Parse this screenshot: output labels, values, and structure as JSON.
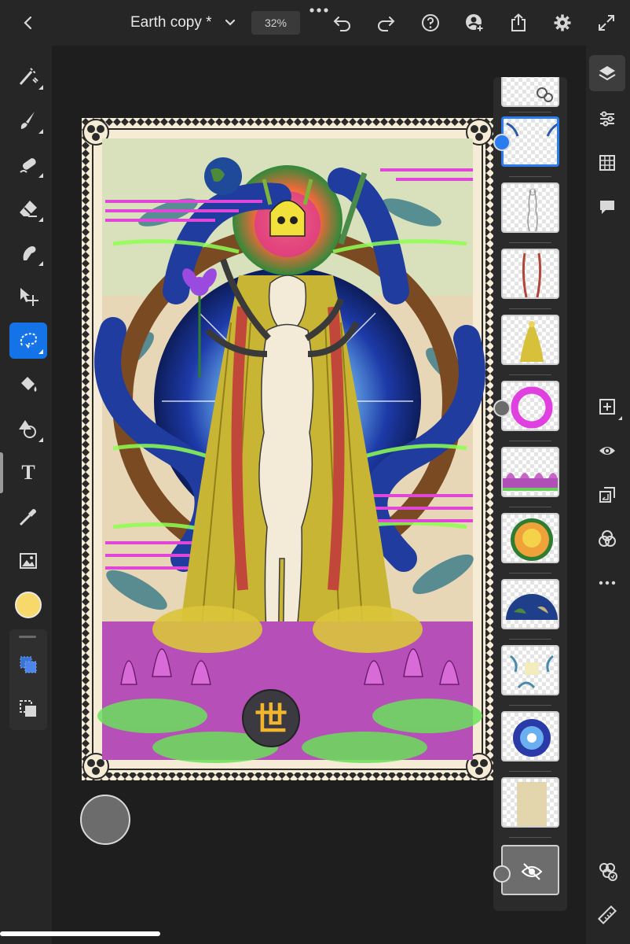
{
  "app": {
    "document_title": "Earth copy *",
    "zoom_level": "32%"
  },
  "topbar": {
    "back_icon": "chevron-left-icon",
    "title_dropdown_icon": "chevron-down-icon",
    "more_icon": "ellipsis-icon",
    "undo_icon": "undo-icon",
    "redo_icon": "redo-icon",
    "help_icon": "help-icon",
    "add_person_icon": "invite-person-icon",
    "share_icon": "share-icon",
    "settings_icon": "gear-icon",
    "fullscreen_icon": "expand-icon"
  },
  "left_tools": [
    {
      "name": "select-subject-tool",
      "icon": "magic-brush-icon"
    },
    {
      "name": "brush-tool",
      "icon": "brush-icon"
    },
    {
      "name": "healing-tool",
      "icon": "healing-brush-icon"
    },
    {
      "name": "eraser-tool",
      "icon": "eraser-icon"
    },
    {
      "name": "smudge-tool",
      "icon": "smudge-icon"
    },
    {
      "name": "move-tool",
      "icon": "move-icon"
    },
    {
      "name": "lasso-tool",
      "icon": "lasso-icon",
      "active": true
    },
    {
      "name": "fill-tool",
      "icon": "paint-bucket-icon"
    },
    {
      "name": "shape-tool",
      "icon": "shape-icon"
    },
    {
      "name": "type-tool",
      "icon": "type-icon",
      "glyph": "T"
    },
    {
      "name": "eyedropper-tool",
      "icon": "eyedropper-icon"
    },
    {
      "name": "place-image-tool",
      "icon": "image-icon"
    }
  ],
  "foreground_color": "#f7d86b",
  "accent_color": "#1473e6",
  "right_tools": [
    {
      "name": "layers-button",
      "icon": "layers-icon",
      "active": true
    },
    {
      "name": "adjustments-button",
      "icon": "sliders-icon"
    },
    {
      "name": "grid-button",
      "icon": "grid-icon"
    },
    {
      "name": "comments-button",
      "icon": "comment-icon"
    },
    {
      "name": "add-layer-button",
      "icon": "add-layer-icon"
    },
    {
      "name": "visibility-button",
      "icon": "eye-icon"
    },
    {
      "name": "merge-down-button",
      "icon": "merge-icon"
    },
    {
      "name": "blend-mode-button",
      "icon": "blend-icon"
    },
    {
      "name": "more-button",
      "icon": "ellipsis-icon"
    },
    {
      "name": "cloud-sync-button",
      "icon": "cloud-sync-icon"
    },
    {
      "name": "measure-button",
      "icon": "ruler-icon"
    }
  ],
  "layers": [
    {
      "name": "layer-top-partial",
      "content": "white-shapes"
    },
    {
      "name": "layer-dragons",
      "content": "transparent-dragons",
      "selected": true
    },
    {
      "name": "layer-figure-lineart",
      "content": "figure-sketch"
    },
    {
      "name": "layer-legs",
      "content": "red-legs"
    },
    {
      "name": "layer-yellow-figure",
      "content": "yellow-figure"
    },
    {
      "name": "layer-pink-ring",
      "content": "pink-ring"
    },
    {
      "name": "layer-lotus-row",
      "content": "lotus-row"
    },
    {
      "name": "layer-sun",
      "content": "sun-circle"
    },
    {
      "name": "layer-earth",
      "content": "earth-half"
    },
    {
      "name": "layer-foliage",
      "content": "blue-foliage"
    },
    {
      "name": "layer-blue-mandala",
      "content": "blue-mandala"
    },
    {
      "name": "layer-paper-texture",
      "content": "paper"
    },
    {
      "name": "layer-hidden-background",
      "content": "hidden-gray",
      "hidden_icon": "eye-off-icon"
    }
  ],
  "artwork": {
    "kanji": "世"
  }
}
